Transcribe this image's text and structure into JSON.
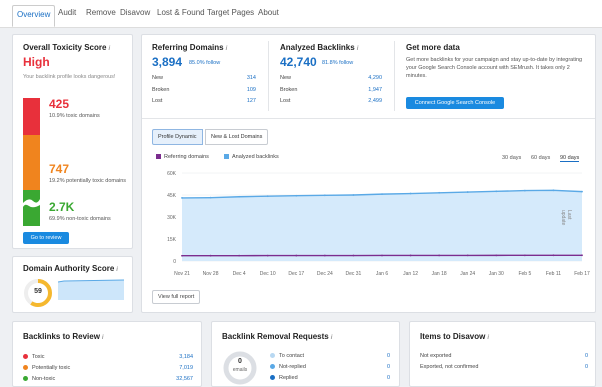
{
  "tabs": [
    "Overview",
    "Audit",
    "Remove",
    "Disavow",
    "Lost & Found",
    "Target Pages",
    "About"
  ],
  "toxicity": {
    "title": "Overall Toxicity Score",
    "level": "High",
    "desc": "Your backlink profile looks dangerous!",
    "toxic": {
      "count": "425",
      "label": "10.9% toxic domains"
    },
    "potential": {
      "count": "747",
      "label": "19.2% potentially toxic domains"
    },
    "non_toxic": {
      "count": "2.7K",
      "label": "69.9% non-toxic domains"
    },
    "button": "Go to review",
    "colors": {
      "toxic": "#e8303b",
      "potential": "#f0841e",
      "non_toxic": "#3aa832"
    }
  },
  "authority": {
    "title": "Domain Authority Score",
    "score": "59"
  },
  "referring": {
    "title": "Referring Domains",
    "value": "3,894",
    "follow": "85.0% follow",
    "rows": [
      {
        "label": "New",
        "value": "314"
      },
      {
        "label": "Broken",
        "value": "109"
      },
      {
        "label": "Lost",
        "value": "127"
      }
    ]
  },
  "backlinks": {
    "title": "Analyzed Backlinks",
    "value": "42,740",
    "follow": "81.8% follow",
    "rows": [
      {
        "label": "New",
        "value": "4,290"
      },
      {
        "label": "Broken",
        "value": "1,947"
      },
      {
        "label": "Lost",
        "value": "2,499"
      }
    ]
  },
  "getdata": {
    "title": "Get more data",
    "text": "Get more backlinks for your campaign and stay up-to-date by integrating your Google Search Console account with SEMrush. It takes only 2 minutes.",
    "button": "Connect Google Search Console"
  },
  "chart_controls": {
    "tab1": "Profile Dynamic",
    "tab2": "New & Lost Domains",
    "legend1": "Referring domains",
    "legend2": "Analyzed backlinks",
    "ranges": [
      "30 days",
      "60 days",
      "90 days"
    ],
    "side_label": "Last update",
    "view_report": "View full report"
  },
  "chart_data": {
    "type": "area",
    "x": [
      "Nov 21",
      "Nov 28",
      "Dec 4",
      "Dec 10",
      "Dec 17",
      "Dec 24",
      "Dec 31",
      "Jan 6",
      "Jan 12",
      "Jan 18",
      "Jan 24",
      "Jan 30",
      "Feb 5",
      "Feb 11",
      "Feb 17"
    ],
    "yticks": [
      "0",
      "15K",
      "30K",
      "45K",
      "60K"
    ],
    "ylim": [
      0,
      60000
    ],
    "series": [
      {
        "name": "Analyzed backlinks",
        "values": [
          43000,
          43200,
          43800,
          44200,
          44500,
          44800,
          45000,
          45600,
          46000,
          46500,
          47000,
          47500,
          48000,
          48200,
          47300
        ],
        "color": "#5aa9e6"
      },
      {
        "name": "Referring domains",
        "values": [
          3600,
          3620,
          3650,
          3680,
          3700,
          3720,
          3740,
          3760,
          3780,
          3800,
          3820,
          3840,
          3860,
          3880,
          3894
        ],
        "color": "#7b2d8e"
      }
    ]
  },
  "review": {
    "title": "Backlinks to Review",
    "rows": [
      {
        "label": "Toxic",
        "value": "3,184",
        "color": "#e8303b"
      },
      {
        "label": "Potentially toxic",
        "value": "7,019",
        "color": "#f0841e"
      },
      {
        "label": "Non-toxic",
        "value": "32,567",
        "color": "#3aa832"
      }
    ]
  },
  "removal": {
    "title": "Backlink Removal Requests",
    "donut_value": "0",
    "donut_label": "emails",
    "rows": [
      {
        "label": "To contact",
        "value": "0",
        "color": "#b8d8f2"
      },
      {
        "label": "Not-replied",
        "value": "0",
        "color": "#5aa9e6"
      },
      {
        "label": "Replied",
        "value": "0",
        "color": "#1a6fc4"
      }
    ]
  },
  "disavow": {
    "title": "Items to Disavow",
    "rows": [
      {
        "label": "Not exported",
        "value": "0"
      },
      {
        "label": "Exported, not confirmed",
        "value": "0"
      }
    ]
  }
}
